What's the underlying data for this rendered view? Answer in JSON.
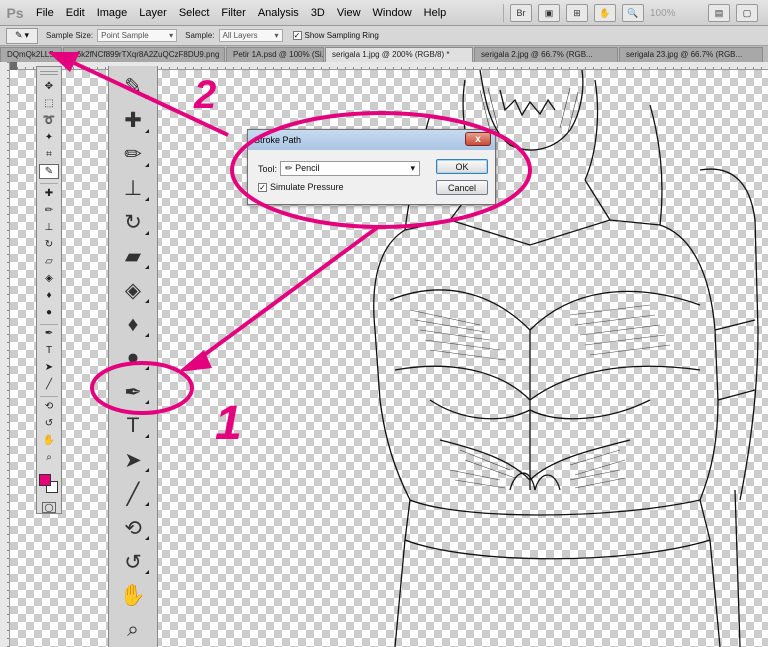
{
  "app": {
    "logo": "Ps",
    "menu": [
      "File",
      "Edit",
      "Image",
      "Layer",
      "Select",
      "Filter",
      "Analysis",
      "3D",
      "View",
      "Window",
      "Help"
    ],
    "zoom": "100%",
    "brand_color": "#e5007e"
  },
  "options_bar": {
    "tool_icon": "eyedropper-icon",
    "sample_size_label": "Sample Size:",
    "sample_size_value": "Point Sample",
    "sample_label": "Sample:",
    "sample_value": "All Layers",
    "show_sampling_ring_label": "Show Sampling Ring",
    "show_sampling_ring_checked": true
  },
  "tabs": [
    {
      "label": "DQmQk2LL5...",
      "active": false
    },
    {
      "label": "...6k2fNCf899rTXqr8A2ZuQCzF8DU9.png",
      "active": false
    },
    {
      "label": "Petir 1A.psd @ 100% (Si...",
      "active": false
    },
    {
      "label": "serigala 1.jpg @ 200% (RGB/8) *",
      "active": true
    },
    {
      "label": "serigala 2.jpg @ 66.7% (RGB...",
      "active": false
    },
    {
      "label": "serigala 23.jpg @ 66.7% (RGB...",
      "active": false
    }
  ],
  "dialog": {
    "title": "Stroke Path",
    "close": "x",
    "tool_label": "Tool:",
    "tool_value": "Pencil",
    "simulate_pressure_label": "Simulate Pressure",
    "simulate_pressure_checked": true,
    "ok_label": "OK",
    "cancel_label": "Cancel"
  },
  "annotations": {
    "step1": "1",
    "step2": "2",
    "color": "#e5007e"
  },
  "swatches": {
    "foreground": "#e8007a",
    "background": "#ffffff"
  }
}
